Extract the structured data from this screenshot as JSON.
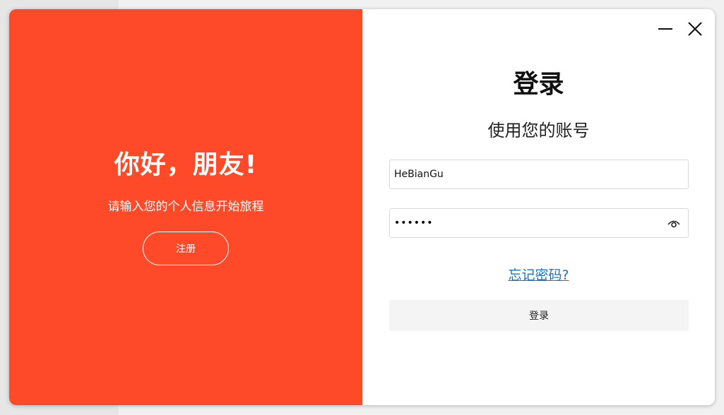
{
  "welcome": {
    "title": "你好，朋友!",
    "subtitle": "请输入您的个人信息开始旅程",
    "register_label": "注册"
  },
  "login": {
    "title": "登录",
    "subtitle": "使用您的账号",
    "username_value": "HeBianGu",
    "password_mask": "••••••",
    "forgot_label": "忘记密码?",
    "submit_label": "登录"
  },
  "window_controls": {
    "minimize_icon": "minimize-icon",
    "close_icon": "close-icon"
  },
  "colors": {
    "accent": "#ff4a2a",
    "link": "#1a73c8",
    "button_bg": "#f4f4f4"
  }
}
